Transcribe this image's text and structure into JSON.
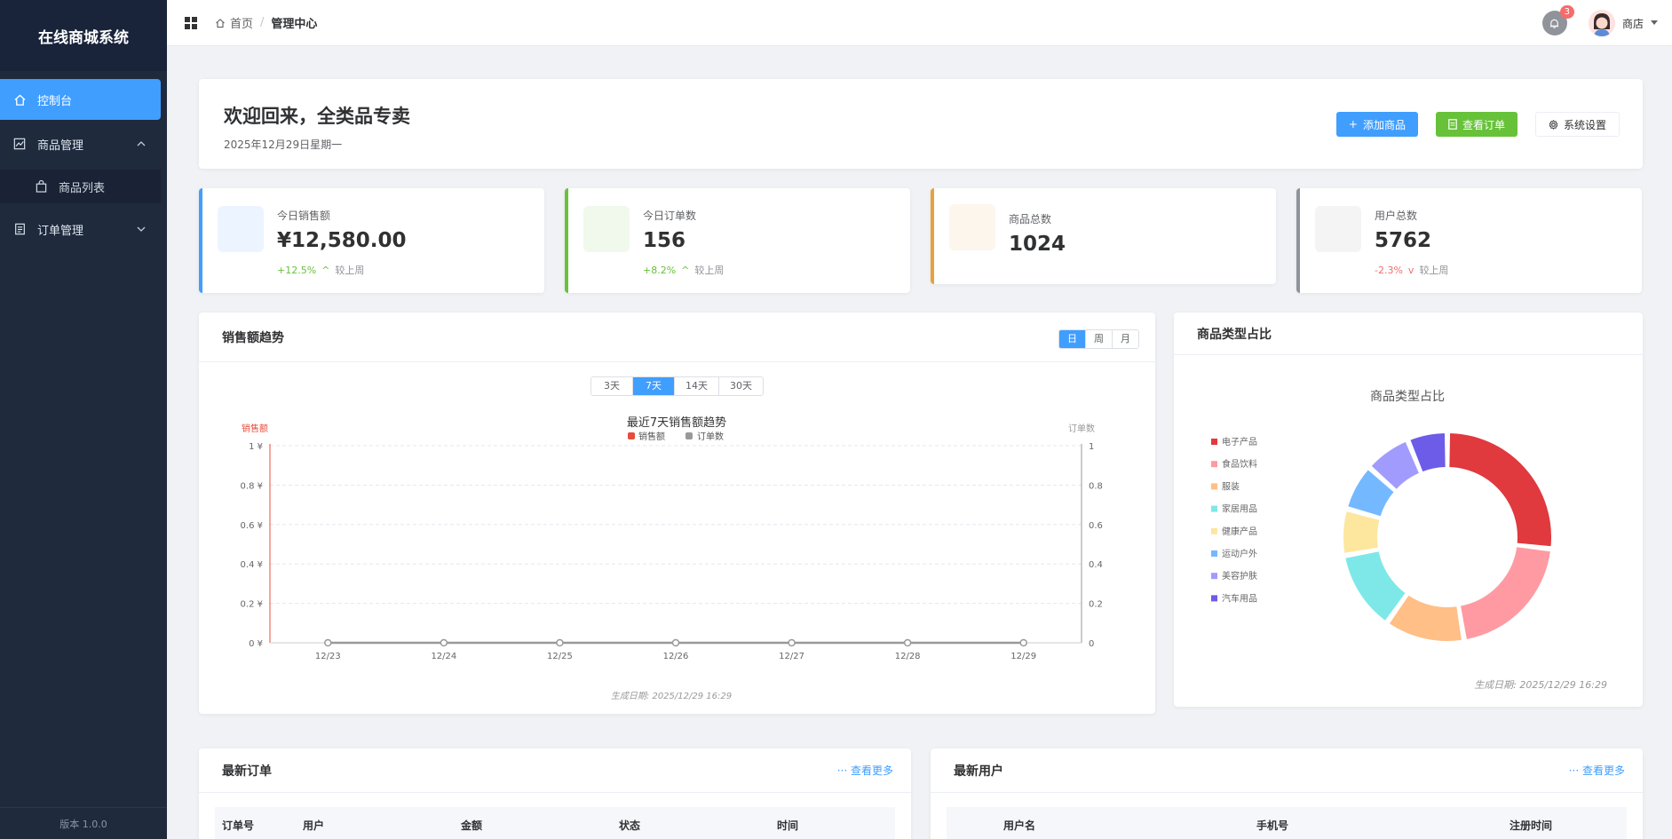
{
  "sidebar": {
    "title": "在线商城系统",
    "items": [
      {
        "label": "控制台",
        "icon": "home-icon"
      },
      {
        "label": "商品管理",
        "icon": "chart-icon"
      },
      {
        "label": "商品列表",
        "icon": "bag-icon"
      },
      {
        "label": "订单管理",
        "icon": "document-icon"
      }
    ],
    "version": "版本 1.0.0"
  },
  "topbar": {
    "breadcrumb_home": "首页",
    "breadcrumb_sep": "/",
    "breadcrumb_current": "管理中心",
    "notification_count": "3",
    "user_name": "商店"
  },
  "welcome": {
    "title": "欢迎回来，全类品专卖",
    "date": "2025年12月29日星期一",
    "buttons": {
      "add_product": "添加商品",
      "view_orders": "查看订单",
      "settings": "系统设置"
    }
  },
  "stats": [
    {
      "label": "今日销售额",
      "value": "¥12,580.00",
      "trend": "+12.5%",
      "trend_dir": "up",
      "compare": "较上周",
      "color": "#409eff"
    },
    {
      "label": "今日订单数",
      "value": "156",
      "trend": "+8.2%",
      "trend_dir": "up",
      "compare": "较上周",
      "color": "#67c23a"
    },
    {
      "label": "商品总数",
      "value": "1024",
      "color": "#e6a23c"
    },
    {
      "label": "用户总数",
      "value": "5762",
      "trend": "-2.3%",
      "trend_dir": "down",
      "compare": "较上周",
      "color": "#909399"
    }
  ],
  "sales_card": {
    "title": "销售额趋势",
    "period_tabs": [
      "日",
      "周",
      "月"
    ],
    "period_selected": "日",
    "range_tabs": [
      "3天",
      "7天",
      "14天",
      "30天"
    ],
    "range_selected": "7天",
    "footer": "生成日期: 2025/12/29 16:29"
  },
  "pie_card": {
    "title": "商品类型占比",
    "footer": "生成日期: 2025/12/29 16:29"
  },
  "chart_data": [
    {
      "type": "line",
      "title": "最近7天销售额趋势",
      "x": [
        "12/23",
        "12/24",
        "12/25",
        "12/26",
        "12/27",
        "12/28",
        "12/29"
      ],
      "series": [
        {
          "name": "销售额",
          "values": [
            0,
            0,
            0,
            0,
            0,
            0,
            0
          ],
          "color": "#e74c3c"
        },
        {
          "name": "订单数",
          "values": [
            0,
            0,
            0,
            0,
            0,
            0,
            0
          ],
          "color": "#999999"
        }
      ],
      "ylabel": "销售额",
      "ylabel_right": "订单数",
      "ylim": [
        0,
        1
      ],
      "y_ticks_left": [
        "0 ¥",
        "0.2 ¥",
        "0.4 ¥",
        "0.6 ¥",
        "0.8 ¥",
        "1 ¥"
      ],
      "y_ticks_right": [
        "0",
        "0.2",
        "0.4",
        "0.6",
        "0.8",
        "1"
      ],
      "grid": true,
      "legend": "top"
    },
    {
      "type": "pie",
      "title": "商品类型占比",
      "categories": [
        "电子产品",
        "食品饮料",
        "服装",
        "家居用品",
        "健康产品",
        "运动户外",
        "美容护肤",
        "汽车用品"
      ],
      "values": [
        26,
        20,
        12,
        12,
        7,
        7,
        7,
        6
      ],
      "colors": [
        "#e0393e",
        "#ff9aa2",
        "#ffbf86",
        "#7ee8e8",
        "#fde69e",
        "#74b9ff",
        "#a29bfe",
        "#6c5ce7"
      ],
      "legend": "left"
    }
  ],
  "orders": {
    "title": "最新订单",
    "more": "查看更多",
    "columns": [
      "订单号",
      "用户",
      "金额",
      "状态",
      "时间"
    ]
  },
  "users": {
    "title": "最新用户",
    "more": "查看更多",
    "columns": [
      "用户名",
      "手机号",
      "注册时间"
    ]
  }
}
